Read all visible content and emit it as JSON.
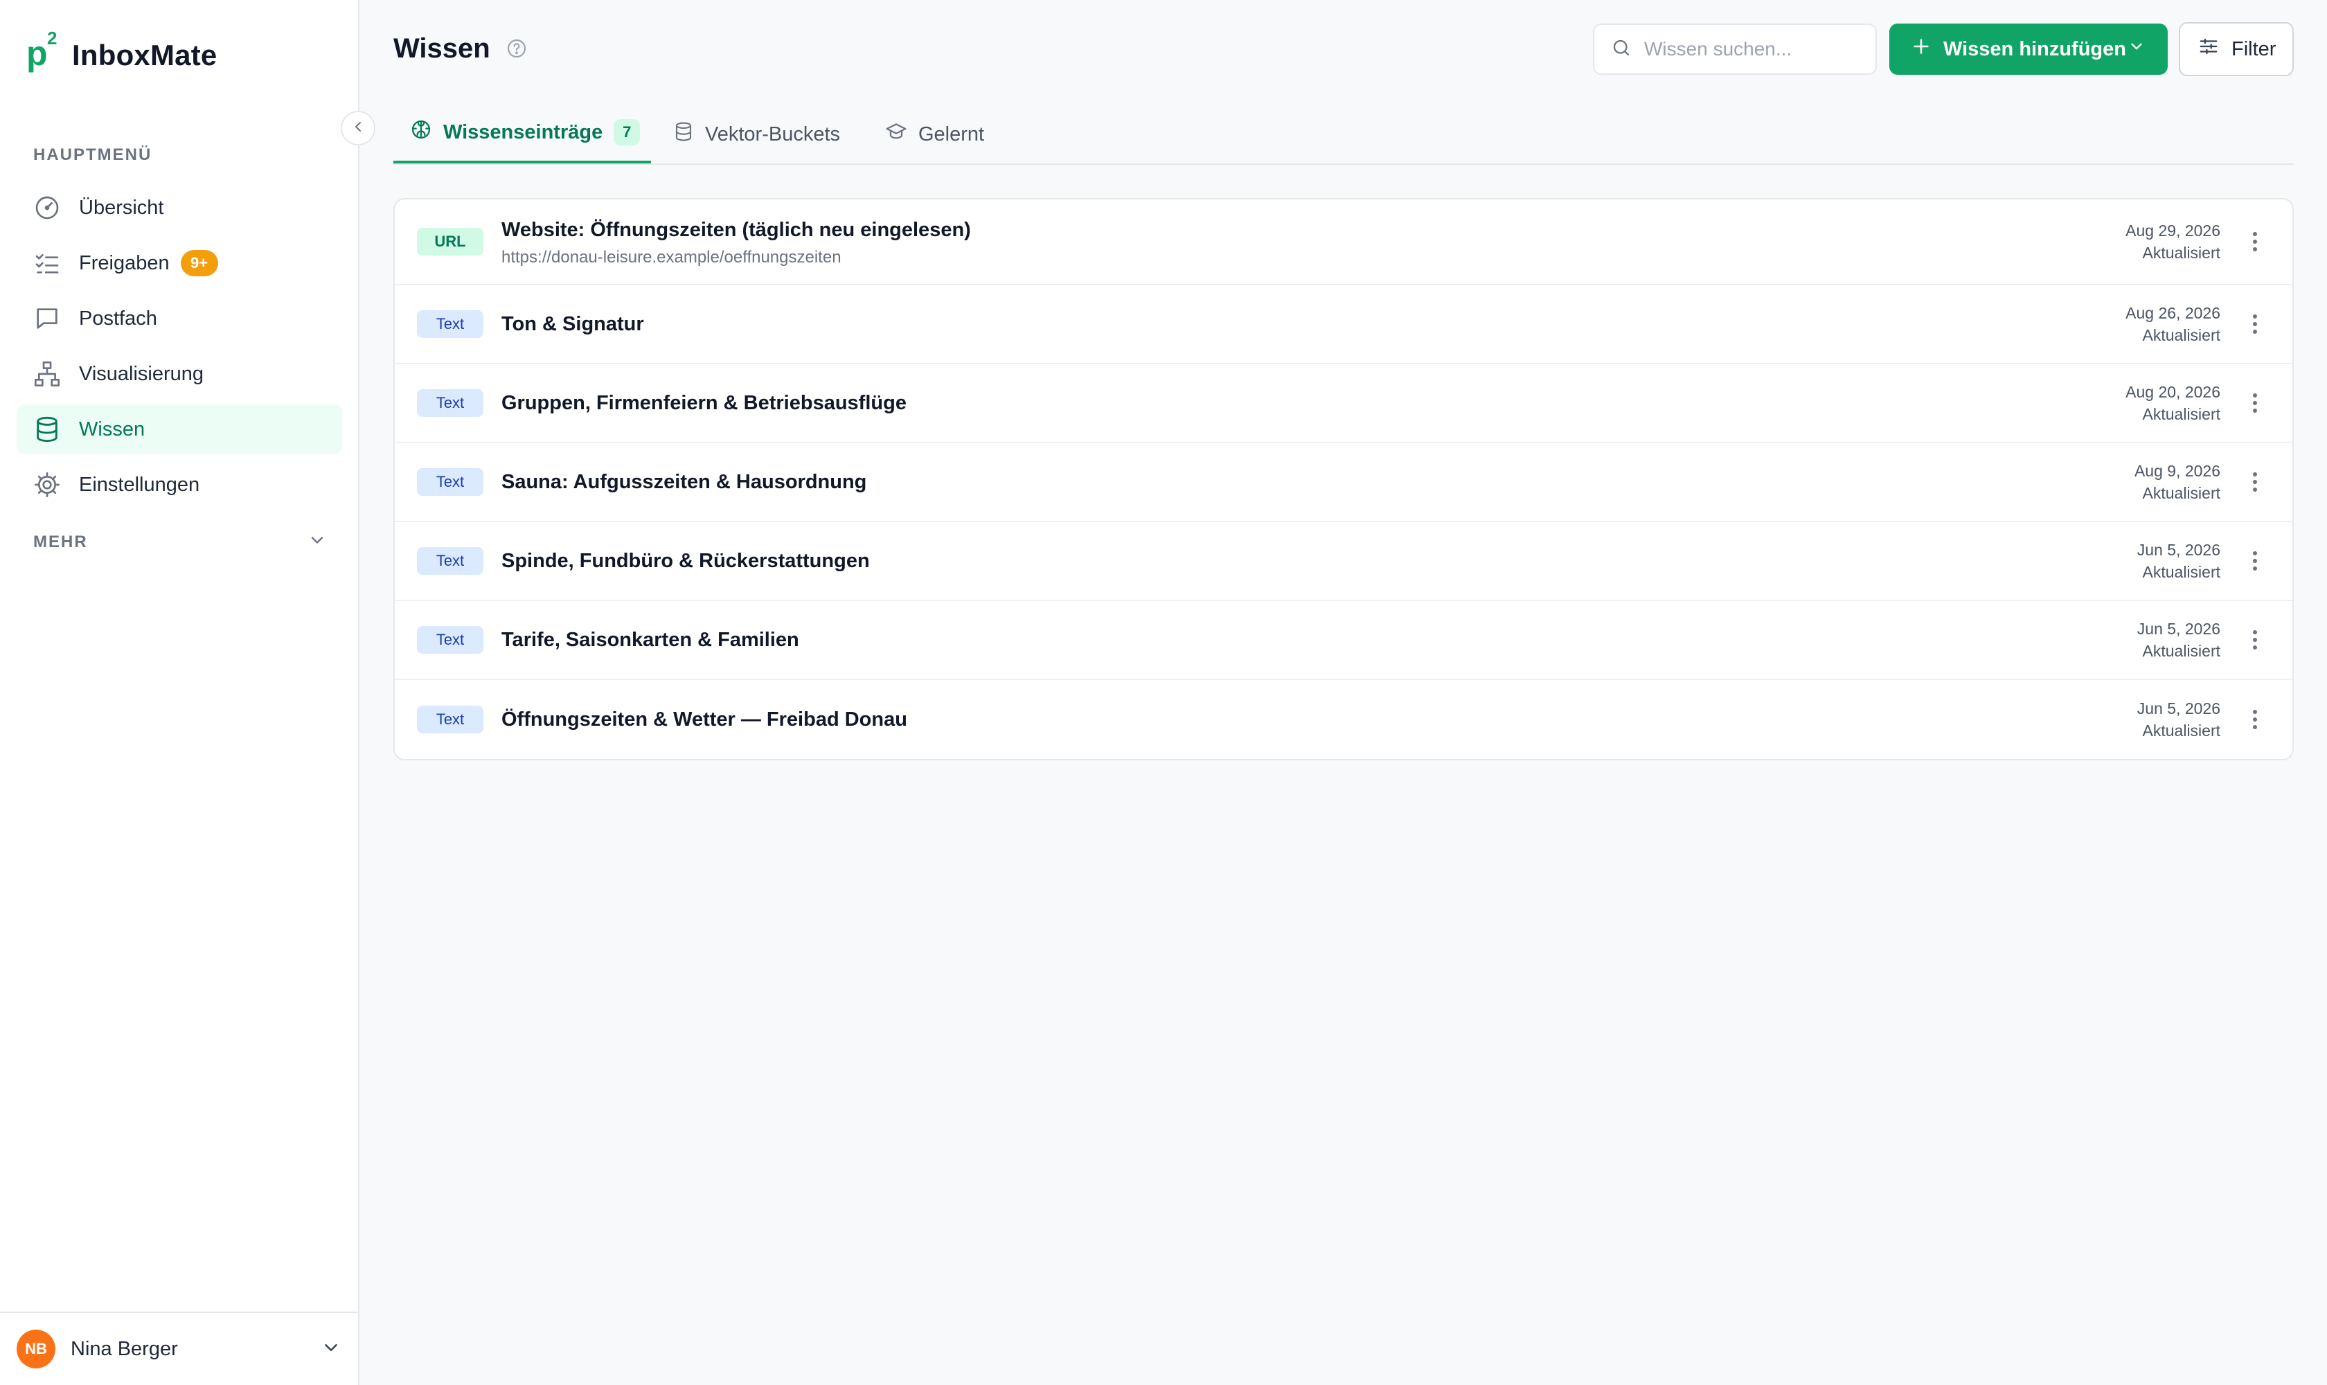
{
  "brand": {
    "name": "InboxMate",
    "mark": "p",
    "mark_sup": "2"
  },
  "sidebar": {
    "section_main": "HAUPTMENÜ",
    "items": [
      {
        "label": "Übersicht",
        "icon": "gauge-icon"
      },
      {
        "label": "Freigaben",
        "icon": "checklist-icon",
        "badge": "9+"
      },
      {
        "label": "Postfach",
        "icon": "chat-icon"
      },
      {
        "label": "Visualisierung",
        "icon": "hierarchy-icon"
      },
      {
        "label": "Wissen",
        "icon": "database-icon",
        "active": true
      },
      {
        "label": "Einstellungen",
        "icon": "gear-icon"
      }
    ],
    "section_more": "MEHR"
  },
  "user": {
    "initials": "NB",
    "name": "Nina Berger",
    "avatar_color": "#f97316"
  },
  "header": {
    "title": "Wissen",
    "search_placeholder": "Wissen suchen...",
    "add_label": "Wissen hinzufügen",
    "filter_label": "Filter"
  },
  "tabs": [
    {
      "label": "Wissenseinträge",
      "count": "7",
      "active": true
    },
    {
      "label": "Vektor-Buckets"
    },
    {
      "label": "Gelernt"
    }
  ],
  "entries": [
    {
      "type": "URL",
      "title": "Website: Öffnungszeiten (täglich neu eingelesen)",
      "subtitle": "https://donau-leisure.example/oeffnungszeiten",
      "date": "Aug 29, 2026",
      "status": "Aktualisiert"
    },
    {
      "type": "Text",
      "title": "Ton & Signatur",
      "date": "Aug 26, 2026",
      "status": "Aktualisiert"
    },
    {
      "type": "Text",
      "title": "Gruppen, Firmenfeiern & Betriebsausflüge",
      "date": "Aug 20, 2026",
      "status": "Aktualisiert"
    },
    {
      "type": "Text",
      "title": "Sauna: Aufgusszeiten & Hausordnung",
      "date": "Aug 9, 2026",
      "status": "Aktualisiert"
    },
    {
      "type": "Text",
      "title": "Spinde, Fundbüro & Rückerstattungen",
      "date": "Jun 5, 2026",
      "status": "Aktualisiert"
    },
    {
      "type": "Text",
      "title": "Tarife, Saisonkarten & Familien",
      "date": "Jun 5, 2026",
      "status": "Aktualisiert"
    },
    {
      "type": "Text",
      "title": "Öffnungszeiten & Wetter — Freibad Donau",
      "date": "Jun 5, 2026",
      "status": "Aktualisiert"
    }
  ],
  "colors": {
    "accent": "#10a566",
    "accent_dark": "#047857",
    "badge": "#f59e0b"
  }
}
